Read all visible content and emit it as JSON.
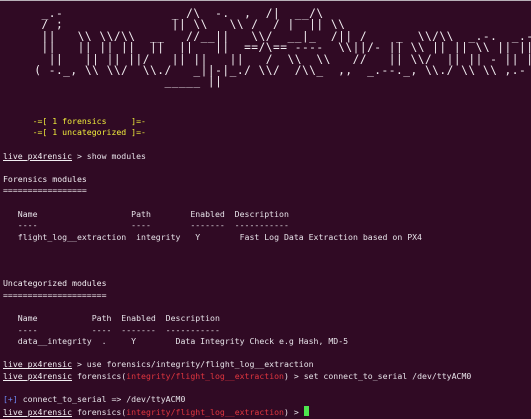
{
  "banner": {
    "ascii_art": "  _.-               _ /\\  -.  ,  /|  __/\\\n  / ;               || \\\\   \\\\ /  / |  || \\\\\n  ||   \\\\ \\\\/\\\\  __   //__||   \\\\/  __|_  /|| /    _  \\\\/\\\\  _.-.  _.-\n  ||   || || ||  ||  ||   ||  ==/\\== ----  \\\\||/- || \\\\ || || \\\\ || ||\n   ||   || || ||/   || ||   ||   /  \\\\  \\\\   //   || \\\\/  || || - || ||\n ( -._, \\\\ \\\\/  \\\\./   _||-|_./ \\\\/  /\\\\_  ,,  _.--._, \\\\./ \\\\ \\\\ ,.-  \\\\ \\\\,/\n                   _____ ||"
  },
  "summary": {
    "forensics_line": "      -=[ 1 forensics     ]=-",
    "uncategorized_line": "      -=[ 1 uncategorized ]=-"
  },
  "session": {
    "prompt_name": "live_px4rensic",
    "cmd_show": " > show modules",
    "forensics_title": "Forensics modules",
    "forensics_rule": "=================",
    "forensics_header": "   Name                   Path        Enabled  Description",
    "forensics_dashes": "   ----                   ----        -------  -----------",
    "forensics_row": "   flight_log__extraction  integrity   Y        Fast Log Data Extraction based on PX4",
    "uncat_title": "Uncategorized modules",
    "uncat_rule": "=====================",
    "uncat_header": "   Name           Path  Enabled  Description",
    "uncat_dashes": "   ----           ----  -------  -----------",
    "uncat_row": "   data__integrity  .     Y        Data Integrity Check e.g Hash, MD-5",
    "cmd_use": " > use forensics/integrity/flight_log__extraction",
    "module_prefix": " forensics(",
    "module_path": "integrity/flight_log__extraction",
    "cmd_set_suffix": ") > set connect_to_serial /dev/ttyACM0",
    "info_tag": "[+]",
    "info_text": " connect_to_serial => /dev/ttyACM0",
    "prompt_suffix": ") > "
  },
  "colors": {
    "background": "#300a24",
    "text": "#e6e2e8",
    "summary": "#f0ee3c",
    "module_path": "#e0353f",
    "cursor": "#4ee64e",
    "info_tag": "#6d86f0"
  }
}
